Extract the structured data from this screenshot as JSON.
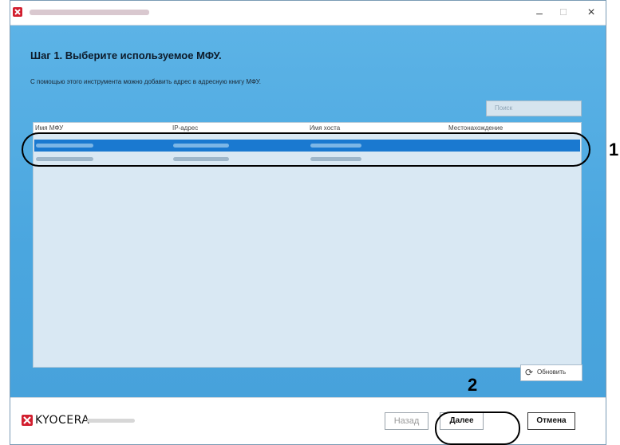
{
  "window": {
    "close_label": "×",
    "minimize_label": "–",
    "maximize_label": "☐"
  },
  "step": {
    "title": "Шаг 1. Выберите используемое МФУ.",
    "description": "С помощью этого инструмента можно добавить адрес в адресную книгу МФУ."
  },
  "search": {
    "placeholder": "Поиск"
  },
  "table": {
    "columns": [
      "Имя МФУ",
      "IP-адрес",
      "Имя хоста",
      "Местонахождение"
    ]
  },
  "refresh": {
    "label": "Обновить",
    "icon": "refresh-icon"
  },
  "footer": {
    "brand": "KYOCERA",
    "back_label": "Назад",
    "next_label": "Далее",
    "cancel_label": "Отмена"
  },
  "callouts": {
    "one": "1",
    "two": "2"
  },
  "colors": {
    "accent": "#4aa6df",
    "selection": "#1a79d0"
  }
}
